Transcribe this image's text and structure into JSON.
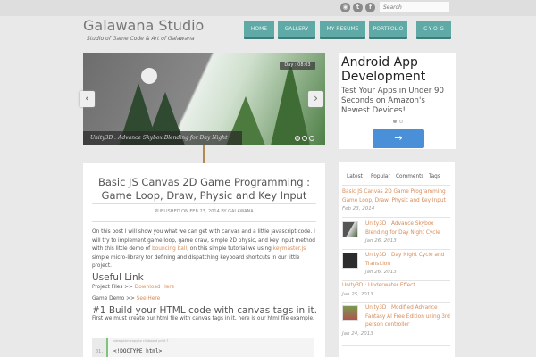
{
  "header": {
    "title": "Galawana Studio",
    "subtitle": "Studio of Game Code & Art of Galawana",
    "search_placeholder": "Search",
    "social": [
      "rss",
      "twitter",
      "facebook"
    ]
  },
  "nav": [
    "HOME",
    "GALLERY",
    "MY RESUME",
    "PORTFOLIO",
    "C-Y-O-G"
  ],
  "slider": {
    "caption": "Unity3D : Advance Skybox Blending for Day Night Cycle",
    "day_label": "Day : 08:03",
    "prev": "‹",
    "next": "›"
  },
  "post": {
    "title": "Basic JS Canvas 2D Game Programming : Game Loop, Draw, Physic and Key Input",
    "meta": "PUBLISHED ON FEB 23, 2014 BY GALAWANA",
    "intro_1": "On this post I will show you what we can get with canvas and a little javascript code. I will try to implement game loop, game draw,  simple 2D physic, and key input method with this little demo of ",
    "link_ball": "bouncing ball,",
    "intro_2": " on this simple tutorial we using ",
    "link_keymaster": "keymaster.js",
    "intro_3": " simple micro-library for defining and dispatching keyboard shortcuts in our little project.",
    "useful_heading": "Useful Link",
    "project_label": "Project Files >> ",
    "project_link": "Download Here",
    "demo_label": "Game Demo >> ",
    "demo_link": "See Here",
    "h1": "#1 Build your HTML code with canvas tags in it.",
    "h1_text": "First we must create our html file with canvas tags in it, here is our html file example.",
    "code_toolbar": "view plain   copy to clipboard   print   ?",
    "code_line_no": "01.",
    "code_line": "<!DOCTYPE html>"
  },
  "ad": {
    "headline": "Android App Development",
    "text": "Test Your Apps in Under 90 Seconds on Amazon's Newest Devices!",
    "button": "→"
  },
  "widget": {
    "tabs": [
      "Latest",
      "Popular",
      "Comments",
      "Tags"
    ],
    "items": [
      {
        "title": "Basic JS Canvas 2D Game Programming : Game Loop, Draw, Physic and Key Input",
        "date": "Feb 23, 2014"
      },
      {
        "title": "Unity3D : Advance Skybox Blending for Day Night Cycle",
        "date": "Jan 26, 2013"
      },
      {
        "title": "Unity3D : Day Night Cycle and Transition",
        "date": "Jan 26, 2013"
      },
      {
        "title": "Unity3D : Underwater Effect",
        "date": "Jan 25, 2013"
      },
      {
        "title": "Unity3D : Modified Advance Fantasy AI Free Edition using 3rd person controller",
        "date": "Jan 24, 2013"
      }
    ]
  }
}
